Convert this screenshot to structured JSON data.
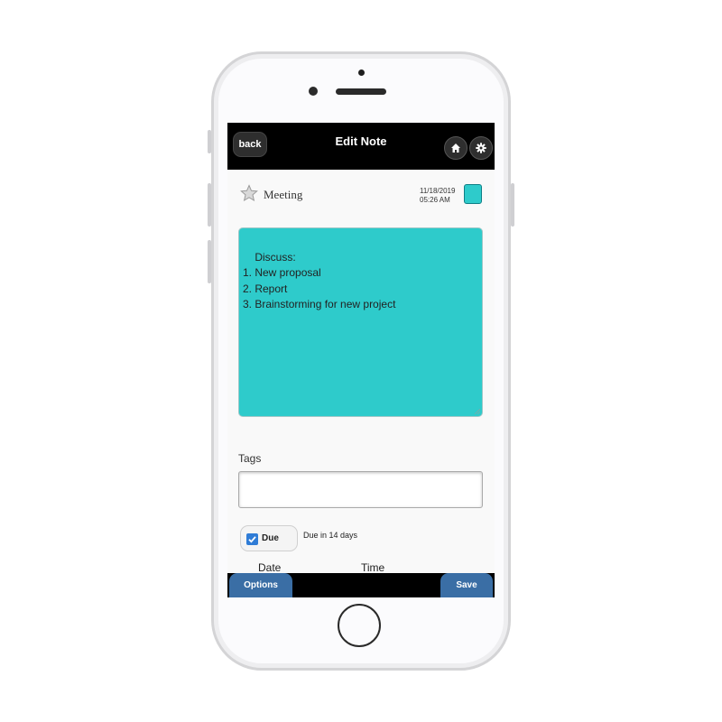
{
  "header": {
    "back_label": "back",
    "title": "Edit Note",
    "home_icon": "home-icon",
    "settings_icon": "gear-icon"
  },
  "note": {
    "title": "Meeting",
    "timestamp": "11/18/2019 05:26 AM",
    "color": "#2ecbcb",
    "body": "Discuss:\n1. New proposal\n2. Report\n3. Brainstorming for new project",
    "starred": false
  },
  "tags": {
    "label": "Tags",
    "value": ""
  },
  "due": {
    "checkbox_label": "Due",
    "checked": true,
    "summary": "Due in 14 days",
    "date_label": "Date",
    "time_label": "Time"
  },
  "footer": {
    "options_label": "Options",
    "save_label": "Save",
    "button_color": "#3a6ea5"
  }
}
